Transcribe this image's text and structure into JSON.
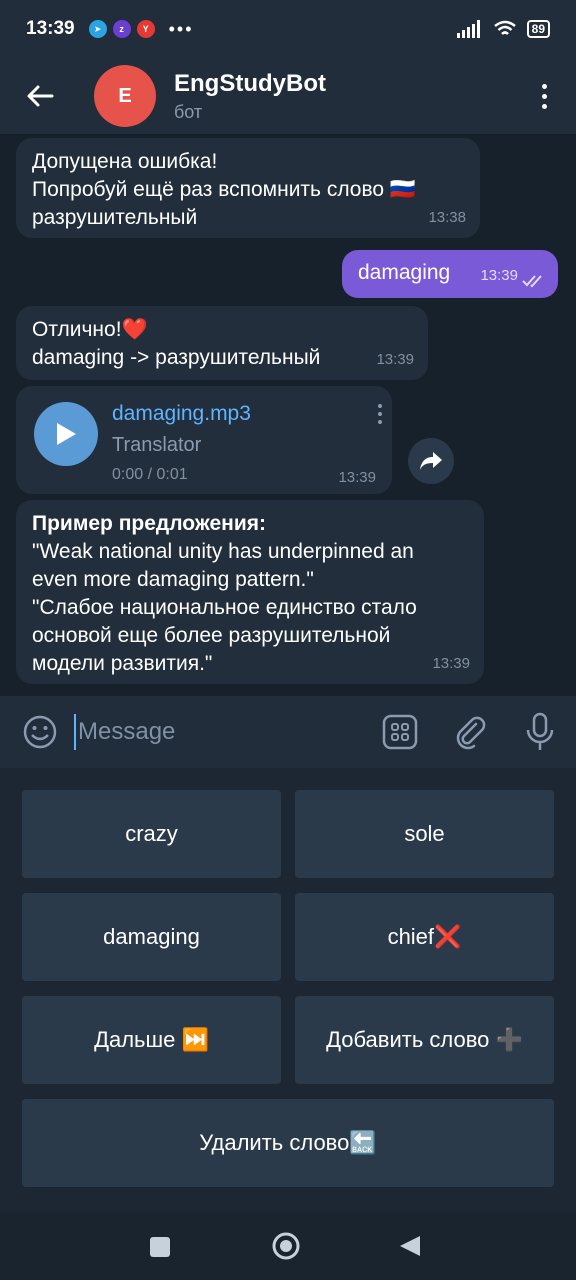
{
  "status_bar": {
    "time": "13:39",
    "battery": "89",
    "more": "•••"
  },
  "header": {
    "avatar_letter": "E",
    "title": "EngStudyBot",
    "subtitle": "бот"
  },
  "messages": [
    {
      "type": "in",
      "lines": [
        "Допущена ошибка!",
        "Попробуй ещё раз вспомнить слово 🇷🇺",
        "разрушительный"
      ],
      "time": "13:38"
    },
    {
      "type": "out",
      "text": "damaging",
      "time": "13:39"
    },
    {
      "type": "in",
      "lines": [
        "Отлично!❤️",
        "damaging -> разрушительный"
      ],
      "time": "13:39"
    },
    {
      "type": "in",
      "title": "Пример предложения:",
      "lines": [
        "\"Weak national unity has underpinned an",
        "even more damaging pattern.\"",
        "\"Слабое национальное единство стало",
        "основой еще более разрушительной",
        "модели развития.\""
      ],
      "time": "13:39"
    }
  ],
  "audio": {
    "file_name": "damaging.mp3",
    "performer": "Translator",
    "duration": "0:00 / 0:01",
    "time": "13:39"
  },
  "input": {
    "placeholder": "Message"
  },
  "keyboard": [
    [
      "crazy",
      "sole"
    ],
    [
      "damaging",
      "chief❌"
    ],
    [
      "Дальше ⏭️",
      "Добавить слово ➕"
    ],
    [
      "Удалить слово🔙"
    ]
  ]
}
